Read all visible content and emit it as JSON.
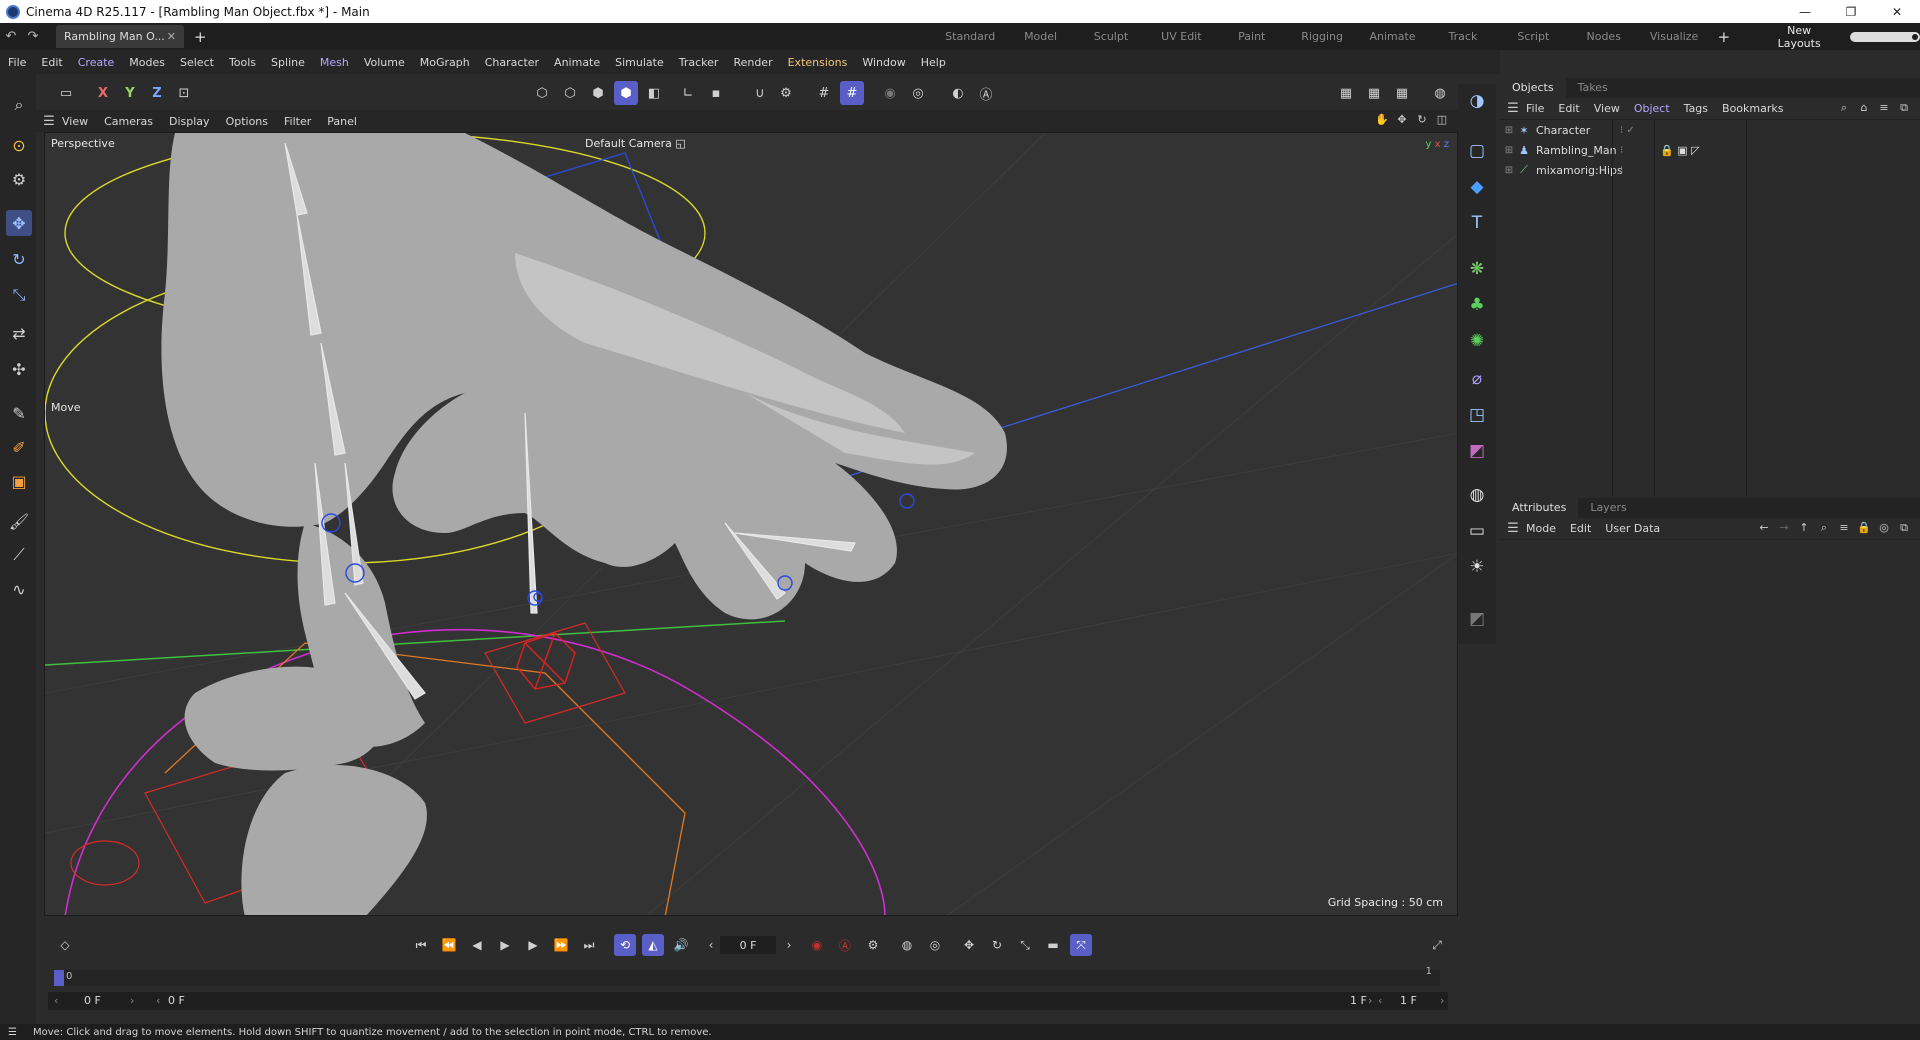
{
  "window": {
    "title": "Cinema 4D R25.117 - [Rambling Man Object.fbx *] - Main",
    "controls": [
      "—",
      "❐",
      "✕"
    ]
  },
  "tabs": {
    "doc_tab": "Rambling Man O...",
    "layouts": [
      "Standard",
      "Model",
      "Sculpt",
      "UV Edit",
      "Paint",
      "Rigging",
      "Animate",
      "Track",
      "Script",
      "Nodes",
      "Visualize"
    ],
    "add_layout": "+",
    "new_layouts": "New Layouts"
  },
  "menubar": [
    "File",
    "Edit",
    "Create",
    "Modes",
    "Select",
    "Tools",
    "Spline",
    "Mesh",
    "Volume",
    "MoGraph",
    "Character",
    "Animate",
    "Simulate",
    "Tracker",
    "Render",
    "Extensions",
    "Window",
    "Help"
  ],
  "toolbar": {
    "axis_x": "X",
    "axis_y": "Y",
    "axis_z": "Z"
  },
  "viewport": {
    "menu": [
      "View",
      "Cameras",
      "Display",
      "Options",
      "Filter",
      "Panel"
    ],
    "view_name": "Perspective",
    "camera": "Default Camera",
    "camera_icon": "camera-icon",
    "tool_label": "Move",
    "grid_spacing": "Grid Spacing : 50 cm"
  },
  "objects_panel": {
    "tabs": [
      "Objects",
      "Takes"
    ],
    "menu": [
      "File",
      "Edit",
      "View",
      "Object",
      "Tags",
      "Bookmarks"
    ],
    "rows": [
      {
        "name": "Character",
        "icon": "character-icon"
      },
      {
        "name": "Rambling_Man",
        "icon": "figure-icon"
      },
      {
        "name": "mixamorig:Hips",
        "icon": "joint-icon"
      }
    ]
  },
  "attributes_panel": {
    "tabs": [
      "Attributes",
      "Layers"
    ],
    "menu": [
      "Mode",
      "Edit",
      "User Data"
    ]
  },
  "timeline": {
    "current_frame": "0 F",
    "ruler_start": "0",
    "ruler_end": "1",
    "range_start": "0 F",
    "range_min": "0 F",
    "range_max": "1 F",
    "range_end": "1 F"
  },
  "status": {
    "text": "Move: Click and drag to move elements. Hold down SHIFT to quantize movement / add to the selection in point mode, CTRL to remove."
  },
  "colors": {
    "accent": "#5a5ec7",
    "menu_accent": "#b7a7ff",
    "extensions": "#f0c77a",
    "viewport_bg": "#333333"
  }
}
